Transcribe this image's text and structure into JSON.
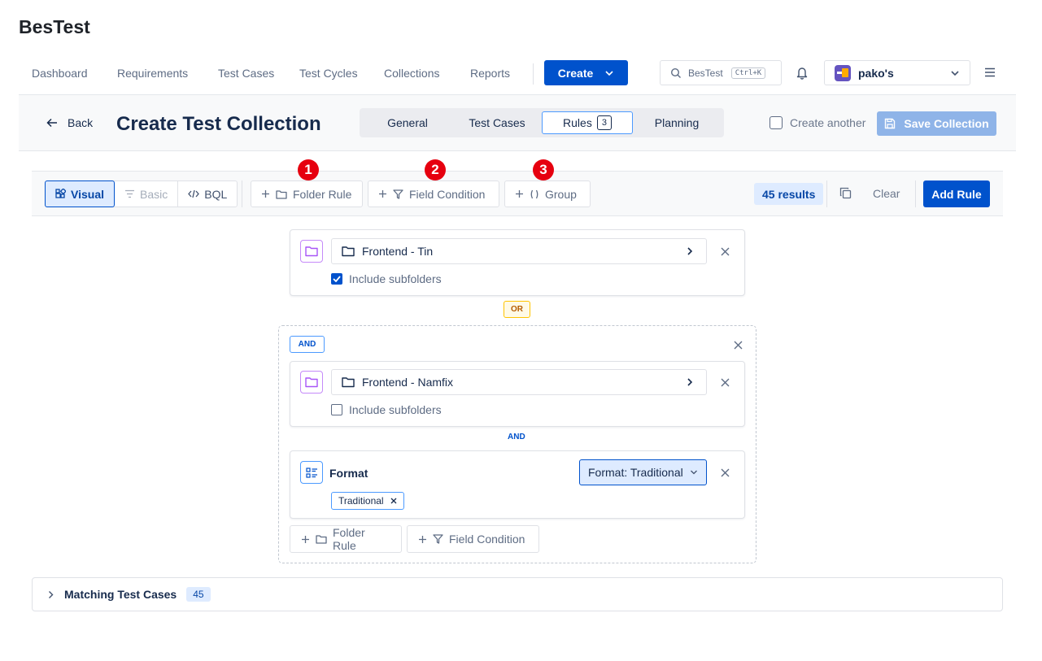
{
  "app": {
    "title": "BesTest"
  },
  "nav": {
    "items": [
      "Dashboard",
      "Requirements",
      "Test Cases",
      "Test Cycles",
      "Collections",
      "Reports"
    ],
    "create_label": "Create",
    "search_placeholder": "BesTest",
    "search_shortcut": "Ctrl+K",
    "workspace": "pako's"
  },
  "header": {
    "back_label": "Back",
    "title": "Create Test Collection",
    "tabs": [
      {
        "label": "General"
      },
      {
        "label": "Test Cases"
      },
      {
        "label": "Rules",
        "badge": "3",
        "active": true
      },
      {
        "label": "Planning"
      }
    ],
    "create_another_label": "Create another",
    "create_another_checked": false,
    "save_label": "Save Collection"
  },
  "toolbar": {
    "modes": [
      {
        "label": "Visual",
        "active": true
      },
      {
        "label": "Basic",
        "disabled": true
      },
      {
        "label": "BQL"
      }
    ],
    "folder_rule_label": "Folder Rule",
    "field_condition_label": "Field Condition",
    "group_label": "Group",
    "markers": [
      "1",
      "2",
      "3"
    ],
    "results_label": "45 results",
    "clear_label": "Clear",
    "add_rule_label": "Add Rule"
  },
  "rules": {
    "rule1": {
      "folder": "Frontend - Tin",
      "include_label": "Include subfolders",
      "include_checked": true
    },
    "or_label": "OR",
    "group": {
      "operator": "AND",
      "rule1": {
        "folder": "Frontend - Namfix",
        "include_label": "Include subfolders",
        "include_checked": false
      },
      "joiner": "AND",
      "rule2": {
        "field": "Format",
        "dropdown": "Format: Traditional",
        "chips": [
          "Traditional"
        ]
      },
      "add_folder_label": "Folder Rule",
      "add_field_label": "Field Condition"
    }
  },
  "matching": {
    "title": "Matching Test Cases",
    "count": "45"
  },
  "colors": {
    "primary": "#0052cc",
    "marker": "#e6000f",
    "folder_accent": "#c58af9",
    "or_accent": "#ffc400"
  }
}
